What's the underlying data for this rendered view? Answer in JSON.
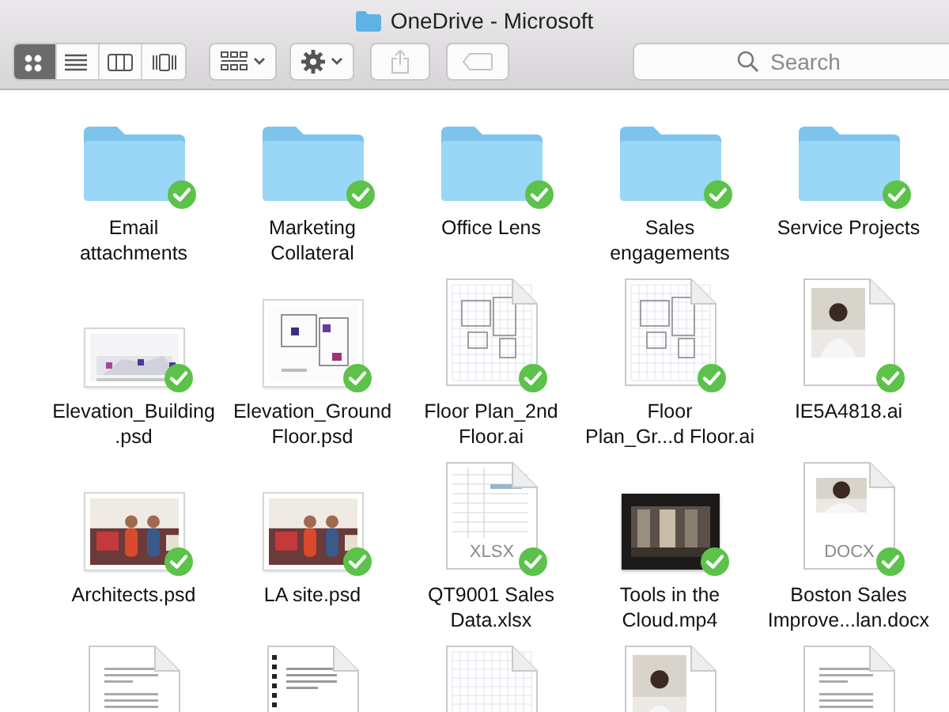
{
  "window": {
    "title": "OneDrive - Microsoft"
  },
  "toolbar": {
    "views": [
      {
        "kind": "icons",
        "selected": true
      },
      {
        "kind": "list",
        "selected": false
      },
      {
        "kind": "columns",
        "selected": false
      },
      {
        "kind": "coverflow",
        "selected": false
      }
    ],
    "share_disabled": true,
    "tags_disabled": true
  },
  "search": {
    "placeholder": "Search"
  },
  "items": [
    {
      "kind": "folder",
      "label": "Email\nattachments",
      "synced": true
    },
    {
      "kind": "folder",
      "label": "Marketing\nCollateral",
      "synced": true
    },
    {
      "kind": "folder",
      "label": "Office Lens",
      "synced": true
    },
    {
      "kind": "folder",
      "label": "Sales\nengagements",
      "synced": true
    },
    {
      "kind": "folder",
      "label": "Service Projects",
      "synced": true
    },
    {
      "kind": "elevation",
      "label": "Elevation_Building\n.psd",
      "synced": true
    },
    {
      "kind": "blueprint",
      "label": "Elevation_Ground\nFloor.psd",
      "synced": true
    },
    {
      "kind": "plandoc",
      "label": "Floor Plan_2nd\nFloor.ai",
      "synced": true
    },
    {
      "kind": "plandoc",
      "label": "Floor\nPlan_Gr...d Floor.ai",
      "synced": true
    },
    {
      "kind": "photodoc",
      "label": "IE5A4818.ai",
      "synced": true
    },
    {
      "kind": "storephoto",
      "label": "Architects.psd",
      "synced": true
    },
    {
      "kind": "storephoto",
      "label": "LA site.psd",
      "synced": true
    },
    {
      "kind": "sheet",
      "badge": "XLSX",
      "label": "QT9001 Sales\nData.xlsx",
      "synced": true
    },
    {
      "kind": "video",
      "label": "Tools in the\nCloud.mp4",
      "synced": true
    },
    {
      "kind": "worddoc",
      "badge": "DOCX",
      "label": "Boston Sales\nImprove...lan.docx",
      "synced": true
    },
    {
      "kind": "textdoc"
    },
    {
      "kind": "bounddoc"
    },
    {
      "kind": "griddoc"
    },
    {
      "kind": "photodoc"
    },
    {
      "kind": "textdoc"
    }
  ]
}
